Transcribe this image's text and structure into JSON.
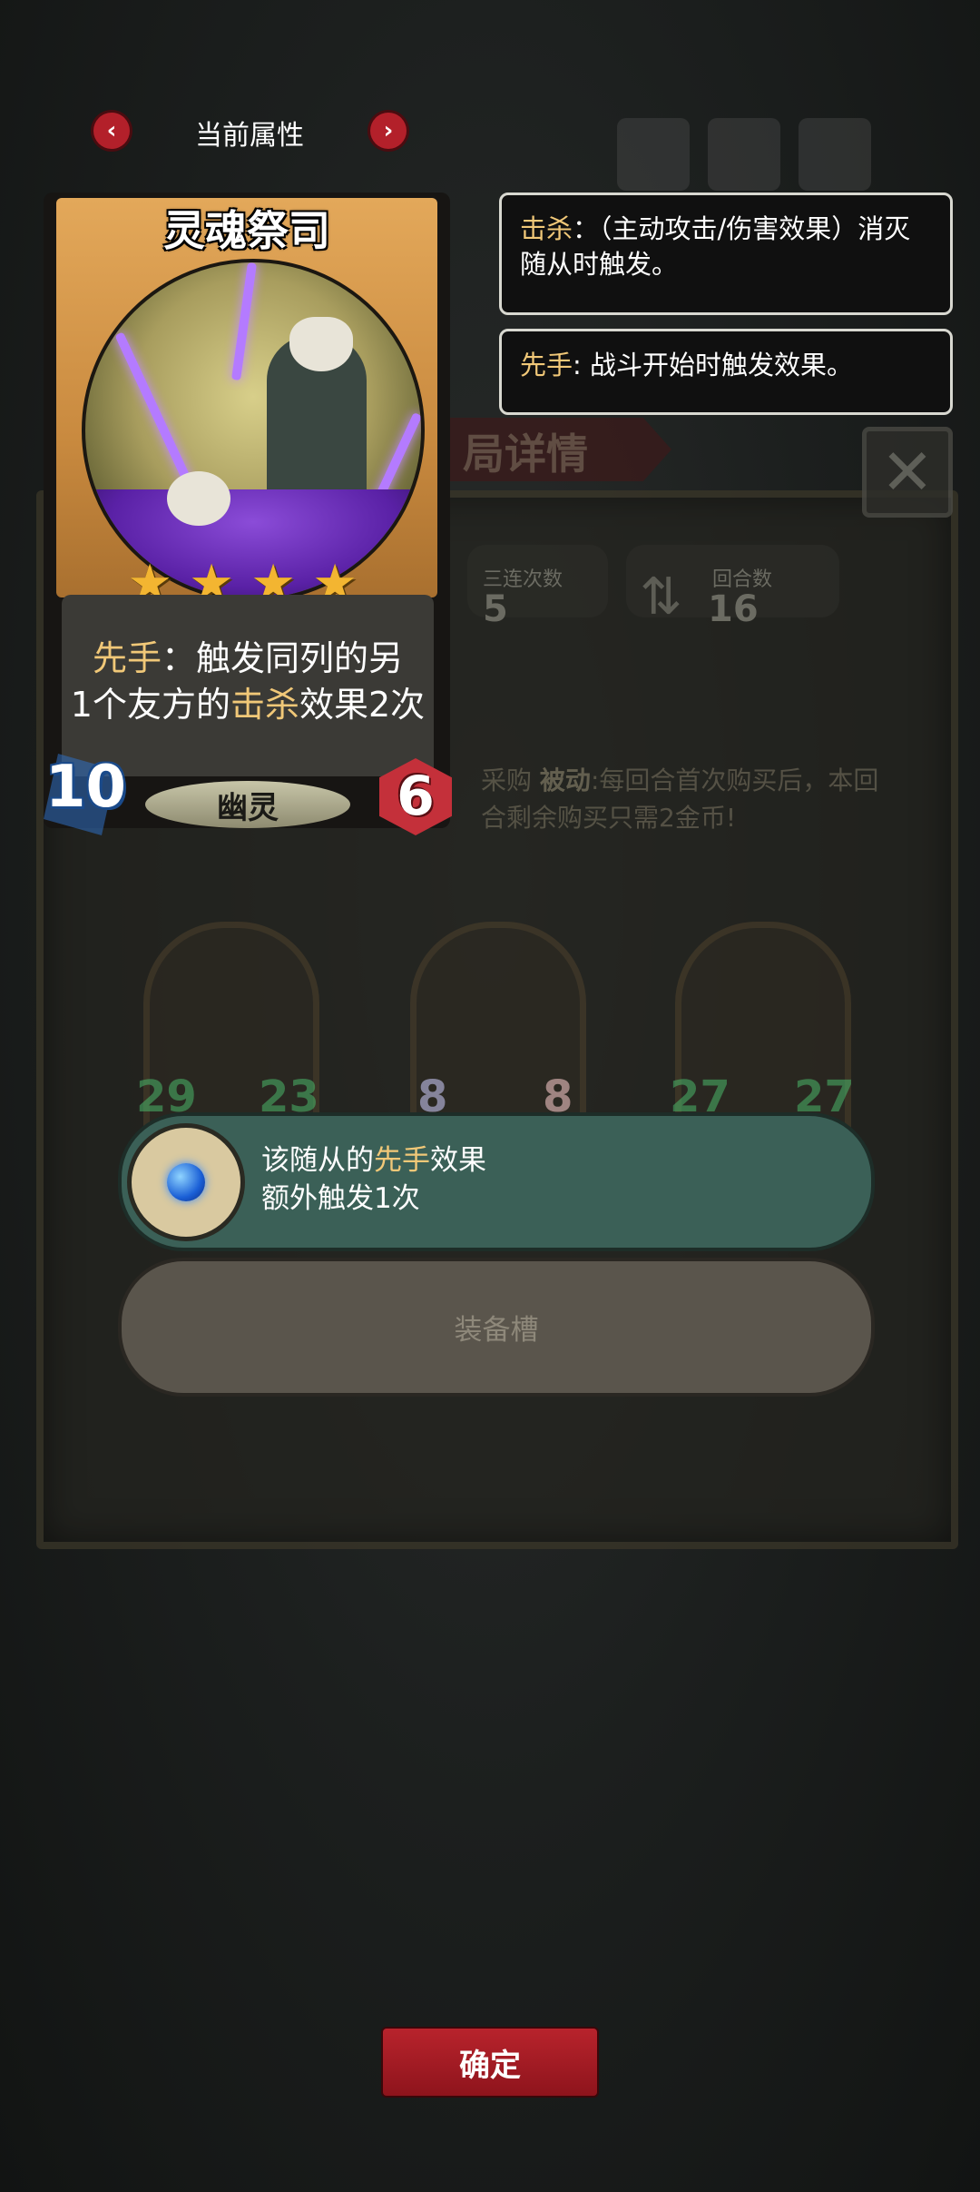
{
  "nav": {
    "title": "当前属性",
    "prev": "‹",
    "next": "›"
  },
  "card": {
    "name": "灵魂祭司",
    "stars": 4,
    "star_glyph": "★",
    "ability_keyword": "先手",
    "ability_line1_rest": "：触发同列的另",
    "ability_line2_a": "1个友方的",
    "ability_keyword2": "击杀",
    "ability_line2_b": "效果2次",
    "tribe": "幽灵",
    "attack": "10",
    "health": "6"
  },
  "tooltips": [
    {
      "keyword": "击杀",
      "text": "：（主动攻击/伤害效果）消灭随从时触发。"
    },
    {
      "keyword": "先手",
      "text": ": 战斗开始时触发效果。"
    }
  ],
  "background": {
    "header": "局详情",
    "close": "✕",
    "stats": [
      {
        "label": "三连次数",
        "value": "5"
      },
      {
        "label": "回合数",
        "value": "16"
      }
    ],
    "passive_title_a": "采购",
    "passive_bold": "被动",
    "passive_text": ":每回合首次购买后，本回合剩余购买只需2金币!",
    "units": [
      {
        "atk": "29",
        "hp": "23"
      },
      {
        "atk": "8",
        "hp": "8"
      },
      {
        "atk": "27",
        "hp": "27"
      }
    ]
  },
  "equipment": {
    "line1_a": "该随从的",
    "keyword": "先手",
    "line1_b": "效果",
    "line2": "额外触发1次",
    "slot_label": "装备槽"
  },
  "confirm_label": "确定",
  "colors": {
    "keyword": "#f1c878",
    "banner": "#3b6057",
    "confirm": "#b8232c"
  }
}
